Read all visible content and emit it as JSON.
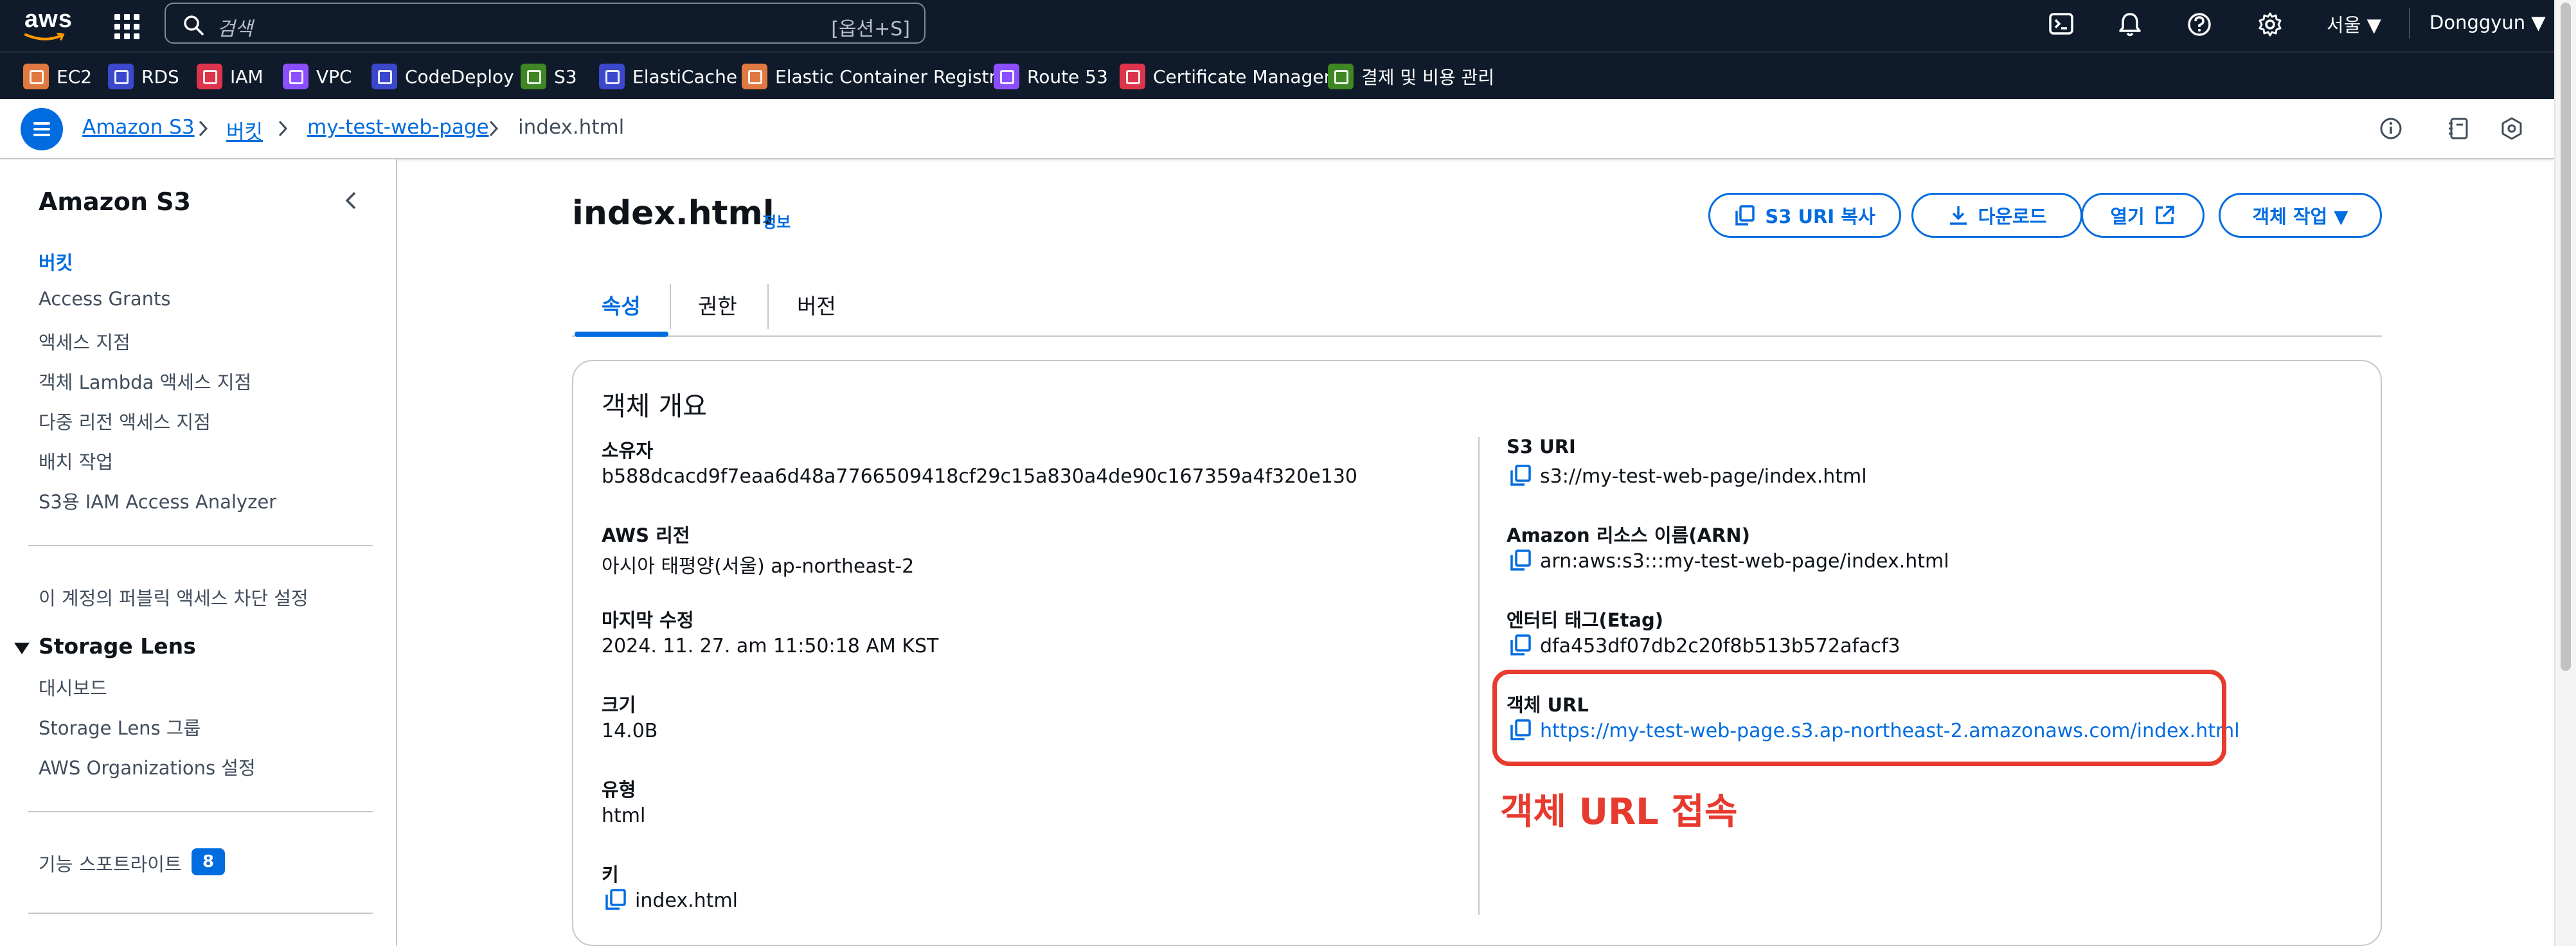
{
  "topnav": {
    "logo_text": "aws",
    "search_placeholder": "검색",
    "search_shortcut": "[옵션+S]",
    "region": "서울 ▼",
    "user": "Donggyun ▼"
  },
  "favorites": [
    {
      "label": "EC2",
      "color": "#e07941"
    },
    {
      "label": "RDS",
      "color": "#3b48cc"
    },
    {
      "label": "IAM",
      "color": "#dd344c"
    },
    {
      "label": "VPC",
      "color": "#8c4fff"
    },
    {
      "label": "CodeDeploy",
      "color": "#3b48cc"
    },
    {
      "label": "S3",
      "color": "#3f8624"
    },
    {
      "label": "ElastiCache",
      "color": "#3b48cc"
    },
    {
      "label": "Elastic Container Registry",
      "color": "#e07941"
    },
    {
      "label": "Route 53",
      "color": "#8c4fff"
    },
    {
      "label": "Certificate Manager",
      "color": "#dd344c"
    },
    {
      "label": "결제 및 비용 관리",
      "color": "#3f8624"
    }
  ],
  "breadcrumb": {
    "items": [
      "Amazon S3",
      "버킷",
      "my-test-web-page",
      "index.html"
    ]
  },
  "sidebar": {
    "title": "Amazon S3",
    "items": [
      "버킷",
      "Access Grants",
      "액세스 지점",
      "객체 Lambda 액세스 지점",
      "다중 리전 액세스 지점",
      "배치 작업",
      "S3용 IAM Access Analyzer"
    ],
    "block_public": "이 계정의 퍼블릭 액세스 차단 설정",
    "storage_lens_title": "Storage Lens",
    "storage_lens_items": [
      "대시보드",
      "Storage Lens 그룹",
      "AWS Organizations 설정"
    ],
    "feature_spotlight": "기능 스포트라이트",
    "feature_badge": "8"
  },
  "page": {
    "title": "index.html",
    "info": "정보",
    "buttons": {
      "copy_uri": "S3 URI 복사",
      "download": "다운로드",
      "open": "열기",
      "actions": "객체 작업 ▼"
    },
    "tabs": [
      "속성",
      "권한",
      "버전"
    ]
  },
  "overview": {
    "title": "객체 개요",
    "left": [
      {
        "label": "소유자",
        "value": "b588dcacd9f7eaa6d48a7766509418cf29c15a830a4de90c167359a4f320e130"
      },
      {
        "label": "AWS 리전",
        "value": "아시아 태평양(서울) ap-northeast-2"
      },
      {
        "label": "마지막 수정",
        "value": "2024. 11. 27. am 11:50:18 AM KST"
      },
      {
        "label": "크기",
        "value": "14.0B"
      },
      {
        "label": "유형",
        "value": "html"
      },
      {
        "label": "키",
        "value": "index.html"
      }
    ],
    "right": [
      {
        "label": "S3 URI",
        "value": "s3://my-test-web-page/index.html"
      },
      {
        "label": "Amazon 리소스 이름(ARN)",
        "value": "arn:aws:s3:::my-test-web-page/index.html"
      },
      {
        "label": "엔터티 태그(Etag)",
        "value": "dfa453df07db2c20f8b513b572afacf3"
      },
      {
        "label": "객체 URL",
        "value": "https://my-test-web-page.s3.ap-northeast-2.amazonaws.com/index.html"
      }
    ]
  },
  "annotation": "객체 URL 접속",
  "colors": {
    "nav_bg": "#0f1b2a",
    "link": "#006ce0",
    "highlight": "#e63b2e"
  }
}
